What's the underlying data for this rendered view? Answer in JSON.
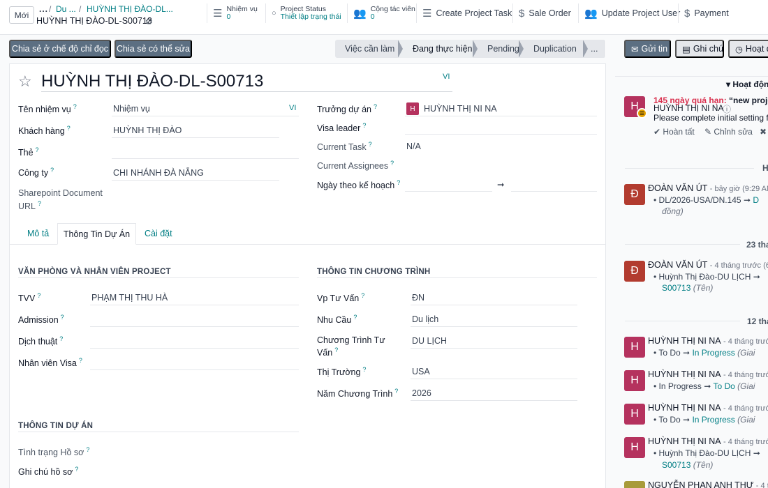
{
  "topbar": {
    "new_label": "Mới",
    "breadcrumb_dots": "...",
    "breadcrumb_sep": "/",
    "breadcrumb_1": "Du ...",
    "breadcrumb_2": "HUỲNH THỊ ĐÀO-DL...",
    "record_name": "HUỲNH THỊ ĐÀO-DL-S00713",
    "smart_buttons": {
      "tasks": {
        "label": "Nhiệm vụ",
        "count": "0"
      },
      "status": {
        "label": "Project Status",
        "value": "Thiết lập trạng thái"
      },
      "collab": {
        "label": "Cộng tác viên",
        "count": "0"
      },
      "create_task": "Create Project Task",
      "sale_order": "Sale Order",
      "update_user": "Update Project User",
      "payment": "Payment"
    }
  },
  "actions": {
    "share_readonly": "Chia sẻ ở chế độ chỉ đọc",
    "share_edit": "Chia sẻ có thể sửa"
  },
  "stages": [
    "Việc cần làm",
    "Đang thực hiện",
    "Pending",
    "Duplication",
    "..."
  ],
  "chatter_buttons": {
    "send": "Gửi tin",
    "note": "Ghi chú",
    "activity": "Hoạt đ"
  },
  "form": {
    "title": "HUỲNH THỊ ĐÀO-DL-S00713",
    "lang": "VI",
    "left": {
      "task_label": "Tên nhiệm vụ",
      "task_value": "Nhiệm vụ",
      "customer_label": "Khách hàng",
      "customer_value": "HUỲNH THỊ ĐÀO",
      "tags_label": "Thẻ",
      "company_label": "Công ty",
      "company_value": "CHI NHÁNH ĐÀ NẴNG",
      "sharepoint_label_1": "Sharepoint Document",
      "sharepoint_label_2": "URL"
    },
    "right": {
      "pm_label": "Trưởng dự án",
      "pm_value": "HUỲNH THỊ NI NA",
      "pm_initial": "H",
      "visa_label": "Visa leader",
      "current_task_label": "Current Task",
      "current_task_value": "N/A",
      "assignees_label": "Current Assignees",
      "planned_label": "Ngày theo kế hoạch",
      "arrow": "➞"
    },
    "tabs": [
      "Mô tả",
      "Thông Tin Dự Án",
      "Cài đặt"
    ],
    "office_section": {
      "title": "VĂN PHÒNG VÀ NHÂN VIÊN PROJECT",
      "tvv_label": "TVV",
      "tvv_value": "PHẠM THỊ THU HÀ",
      "admission_label": "Admission",
      "translate_label": "Dịch thuật",
      "visa_staff_label": "Nhân viên Visa"
    },
    "program_section": {
      "title": "THÔNG TIN CHƯƠNG TRÌNH",
      "office_label": "Vp Tư Vấn",
      "office_value": "ĐN",
      "need_label": "Nhu Cầu",
      "need_value": "Du lịch",
      "program_label_1": "Chương Trình Tư",
      "program_label_2": "Vấn",
      "program_value": "DU LỊCH",
      "market_label": "Thị Trường",
      "market_value": "USA",
      "year_label": "Năm Chương Trình",
      "year_value": "2026"
    },
    "project_section": {
      "title": "THÔNG TIN DỰ ÁN",
      "status_label": "Tình trạng Hồ sơ",
      "note_label": "Ghi chú hồ sơ"
    }
  },
  "chatter": {
    "activities_head": "▾ Hoạt độn",
    "activity": {
      "overdue": "145 ngày quá hạn:",
      "title": "“new proje",
      "user": "HUỲNH THỊ NI NA",
      "text": "Please complete initial setting fo",
      "done": "Hoàn tất",
      "edit": "Chỉnh sửa",
      "initial": "H"
    },
    "date_today": "H",
    "date_23": "23 tha",
    "date_12": "12 tha",
    "messages": [
      {
        "initial": "Đ",
        "author": "ĐOÀN VĂN ÚT",
        "meta": "- bây giờ (9:29 AM",
        "line": "DL/2026-USA/DN.145",
        "arrow": "➞",
        "link": "D",
        "note": "đồng)"
      },
      {
        "initial": "Đ",
        "author": "ĐOÀN VĂN ÚT",
        "meta": "- 4 tháng trước (6:5",
        "line": "Huỳnh Thị Đào-DU LỊCH",
        "arrow": "➞",
        "link": "S00713",
        "note": "(Tên)"
      },
      {
        "initial": "H",
        "author": "HUỲNH THỊ NI NA",
        "meta": "- 4 tháng trước",
        "line": "To Do",
        "arrow": "➞",
        "link": "In Progress",
        "note": "(Giai"
      },
      {
        "initial": "H",
        "author": "HUỲNH THỊ NI NA",
        "meta": "- 4 tháng trước",
        "line": "In Progress",
        "arrow": "➞",
        "link": "To Do",
        "note": "(Giai"
      },
      {
        "initial": "H",
        "author": "HUỲNH THỊ NI NA",
        "meta": "- 4 tháng trước",
        "line": "To Do",
        "arrow": "➞",
        "link": "In Progress",
        "note": "(Giai"
      },
      {
        "initial": "H",
        "author": "HUỲNH THỊ NI NA",
        "meta": "- 4 tháng trước",
        "line": "Huỳnh Thị Đào-DU LỊCH",
        "arrow": "➞",
        "link": "S00713",
        "note": "(Tên)"
      },
      {
        "author": "NGUYỄN PHAN ANH THƯ",
        "meta": "- 4 tháng"
      }
    ]
  },
  "colors": {
    "accent": "#017e84",
    "avatar_h": "#b5325e",
    "avatar_d": "#b23b2f",
    "overdue": "#d9304e",
    "secondary_btn": "#5c6f82"
  }
}
